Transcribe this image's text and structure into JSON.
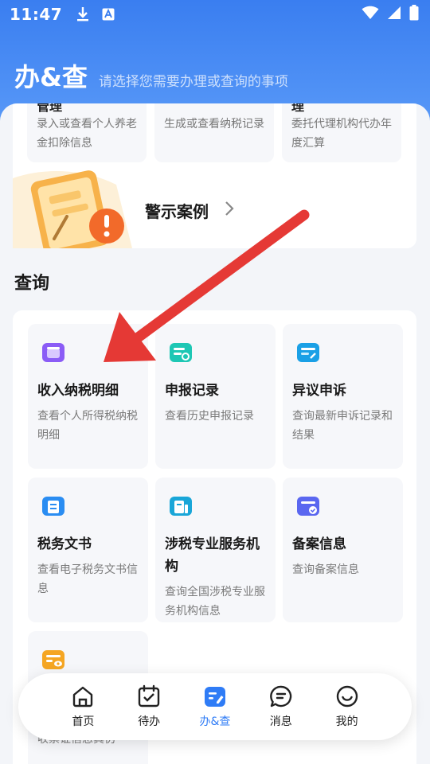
{
  "status_bar": {
    "time": "11:47"
  },
  "header": {
    "title": "办&查",
    "subtitle": "请选择您需要办理或查询的事项"
  },
  "top_cards": [
    {
      "partial_title": "管理",
      "desc": "录入或查看个人养老金扣除信息"
    },
    {
      "partial_title": "",
      "desc": "生成或查看纳税记录"
    },
    {
      "partial_title": "理",
      "desc": "委托代理机构代办年度汇算"
    }
  ],
  "warning": {
    "title": "警示案例"
  },
  "query": {
    "section_title": "查询",
    "items": [
      {
        "name": "收入纳税明细",
        "desc": "查看个人所得税纳税明细",
        "icon": "income-tax-icon",
        "color": "#8b5cf6"
      },
      {
        "name": "申报记录",
        "desc": "查看历史申报记录",
        "icon": "declaration-record-icon",
        "color": "#1ec7b4"
      },
      {
        "name": "异议申诉",
        "desc": "查询最新申诉记录和结果",
        "icon": "appeal-icon",
        "color": "#1aa0e6"
      },
      {
        "name": "税务文书",
        "desc": "查看电子税务文书信息",
        "icon": "tax-document-icon",
        "color": "#2a8df2"
      },
      {
        "name": "涉税专业服务机构",
        "desc": "查询全国涉税专业服务机构信息",
        "icon": "service-agency-icon",
        "color": "#19a6d8"
      },
      {
        "name": "备案信息",
        "desc": "查询备案信息",
        "icon": "filing-info-icon",
        "color": "#5a67f0"
      },
      {
        "name": "",
        "desc": "收票证信息真伪",
        "icon": "receipt-verify-icon",
        "color": "#f5a623"
      }
    ]
  },
  "tabs": [
    {
      "label": "首页",
      "icon": "home-icon",
      "active": false
    },
    {
      "label": "待办",
      "icon": "todo-icon",
      "active": false
    },
    {
      "label": "办&查",
      "icon": "handle-query-icon",
      "active": true
    },
    {
      "label": "消息",
      "icon": "message-icon",
      "active": false
    },
    {
      "label": "我的",
      "icon": "profile-icon",
      "active": false
    }
  ],
  "colors": {
    "brand_blue": "#2f7cf6",
    "arrow_red": "#e53935"
  }
}
